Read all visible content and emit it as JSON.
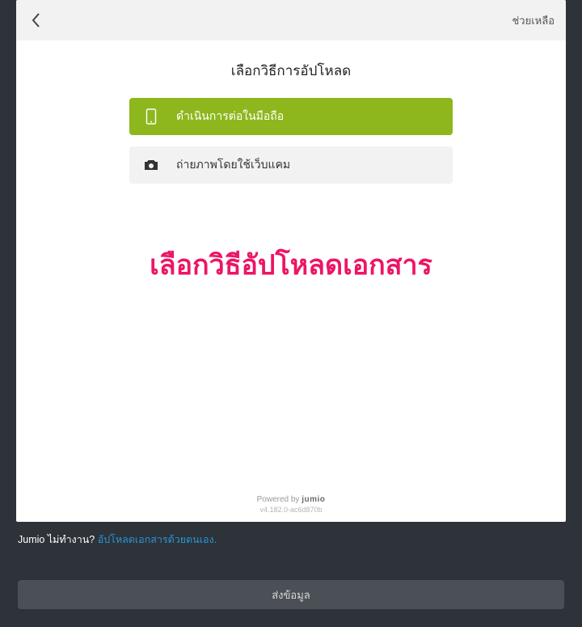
{
  "header": {
    "help_label": "ช่วยเหลือ"
  },
  "main": {
    "title": "เลือกวิธีการอัปโหลด",
    "option_mobile_label": "ดำเนินการต่อในมือถือ",
    "option_webcam_label": "ถ่ายภาพโดยใช้เว็บแคม",
    "overlay_instruction": "เลือกวิธีอัปโหลดเอกสาร"
  },
  "footer": {
    "powered_prefix": "Powered by ",
    "powered_brand": "jumio",
    "version": "v4.182.0-ac6d870b"
  },
  "belowpanel": {
    "prompt": "Jumio ไม่ทำงาน? ",
    "link_text": "อัปโหลดเอกสารด้วยตนเอง."
  },
  "submit": {
    "label": "ส่งข้อมูล"
  },
  "colors": {
    "accent_green": "#8db71d",
    "overlay_pink": "#ed1566",
    "dark_bg": "#2d3338",
    "link_blue": "#2a95d6"
  }
}
